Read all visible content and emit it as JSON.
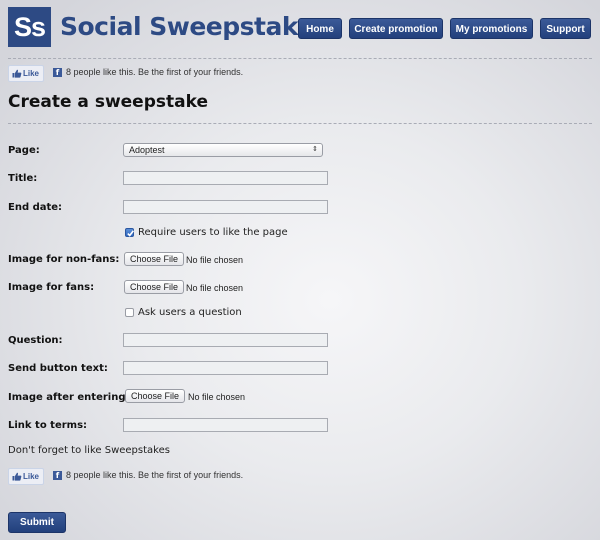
{
  "brand": {
    "logo": "Ss",
    "name": "Social Sweepstakes"
  },
  "nav": [
    "Home",
    "Create promotion",
    "My promotions",
    "Support"
  ],
  "like_widget": {
    "button": "Like",
    "text": "8 people like this. Be the first of your friends."
  },
  "page_title": "Create a sweepstake",
  "form": {
    "page": {
      "label": "Page:",
      "selected": "Adoptest"
    },
    "title": {
      "label": "Title:",
      "value": ""
    },
    "end_date": {
      "label": "End date:",
      "value": ""
    },
    "require_like": {
      "label": "Require users to like the page",
      "checked": true
    },
    "image_non_fans": {
      "label": "Image for non-fans:",
      "button": "Choose File",
      "status": "No file chosen"
    },
    "image_fans": {
      "label": "Image for fans:",
      "button": "Choose File",
      "status": "No file chosen"
    },
    "ask_question": {
      "label": "Ask users a question",
      "checked": false
    },
    "question": {
      "label": "Question:",
      "value": ""
    },
    "send_button_text": {
      "label": "Send button text:",
      "value": ""
    },
    "image_after": {
      "label": "Image after entering:",
      "button": "Choose File",
      "status": "No file chosen"
    },
    "link_terms": {
      "label": "Link to terms:",
      "value": ""
    }
  },
  "reminder": "Don't forget to like Sweepstakes",
  "submit": "Submit",
  "colors": {
    "brand_blue": "#2d4a84",
    "button_blue": "#3b5a98",
    "facebook_blue": "#3b5998"
  }
}
